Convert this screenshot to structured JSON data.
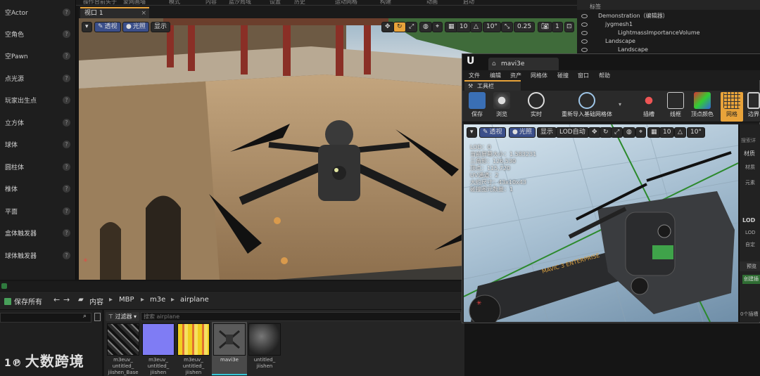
{
  "top_menu": [
    "操作台前头于",
    "蒙网画墙",
    "模式",
    "内容",
    "蓝汐局域",
    "设置",
    "历史",
    "运动网格",
    "构建",
    "动画",
    "启动"
  ],
  "left_panel": {
    "items": [
      {
        "label": "空Actor"
      },
      {
        "label": "空角色"
      },
      {
        "label": "空Pawn"
      },
      {
        "label": "点光源"
      },
      {
        "label": "玩家出生点"
      },
      {
        "label": "立方体"
      },
      {
        "label": "球体"
      },
      {
        "label": "圆柱体"
      },
      {
        "label": "椎体"
      },
      {
        "label": "平面"
      },
      {
        "label": "盒体触发器"
      },
      {
        "label": "球体触发器"
      }
    ]
  },
  "viewport1": {
    "tab_label": "视口 1",
    "close": "×",
    "menu_btn": "▾",
    "perspective_label": "透视",
    "lit_label": "光照",
    "show_label": "显示",
    "grid_value": "10",
    "rotation_value": "10°",
    "scale_value": "0.25",
    "camera_value": "1"
  },
  "outliner": {
    "header": "标签",
    "rows": [
      {
        "label": "Demonstration（编辑器）"
      },
      {
        "label": "jygmesh1"
      },
      {
        "label": "LightmassImportanceVolume"
      },
      {
        "label": "Landscape"
      },
      {
        "label": "Landscape"
      }
    ]
  },
  "content_browser": {
    "save_all_label": "保存所有",
    "path": [
      "内容",
      "MBP",
      "m3e",
      "airplane"
    ],
    "filter_label": "过滤器",
    "search_placeholder": "搜索 airplane",
    "assets": [
      {
        "label": "m3euv_ untitled_ jiishen_Base"
      },
      {
        "label": "m3euv_ untitled_ jiishen"
      },
      {
        "label": "m3euv_ untitled_ jiishen"
      },
      {
        "label": "mavi3e"
      },
      {
        "label": "untitled_ jiishen"
      }
    ]
  },
  "mesh_editor": {
    "tab_title": "mavi3e",
    "menu": [
      "文件",
      "编辑",
      "资产",
      "网格体",
      "碰撞",
      "窗口",
      "帮助"
    ],
    "tool_tab": "工具栏",
    "toolbar": [
      {
        "label": "保存"
      },
      {
        "label": "浏览"
      },
      {
        "label": "实时"
      },
      {
        "label": "重新导入基础网格体"
      },
      {
        "label": "插槽"
      },
      {
        "label": "线框"
      },
      {
        "label": "顶点颜色"
      },
      {
        "label": "网格"
      },
      {
        "label": "边界"
      }
    ],
    "viewport": {
      "perspective_label": "透视",
      "lit_label": "光照",
      "show_label": "显示",
      "lod_label": "LOD自动",
      "grid_value": "10",
      "rotation_value": "10°"
    },
    "stats": [
      "LOD：0",
      "当前屏幕大小：1.583231",
      "三角形：126,530",
      "顶点：115,720",
      "UV通道：2",
      "大约尺寸：43x10x43",
      "碰撞图元数量：1"
    ],
    "side_panel": [
      "搜索详",
      "材质",
      "材质",
      "元素",
      "LOD",
      "LOD",
      "自定",
      "预览",
      "创建插"
    ],
    "bottom_status": "0个插槽"
  },
  "drone_text": "MAVIC 3 ENTERPRISE",
  "watermark": "大数跨境",
  "colors": {
    "accent_orange": "#e8a33a",
    "blue_button": "#3b4f8a",
    "panel": "#1e1e1e"
  }
}
